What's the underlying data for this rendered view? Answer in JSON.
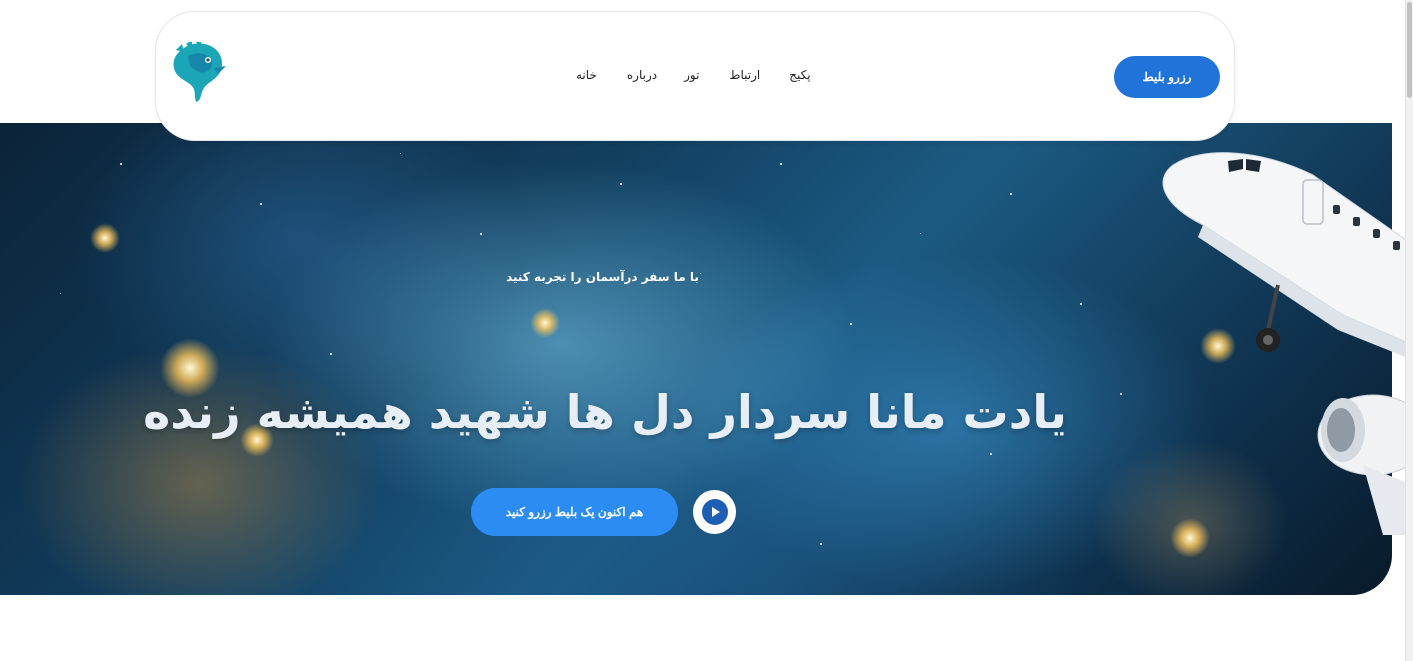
{
  "navbar": {
    "logo_name": "seahorse-logo",
    "links": [
      {
        "label": "خانه"
      },
      {
        "label": "درباره"
      },
      {
        "label": "تور"
      },
      {
        "label": "ارتباط"
      },
      {
        "label": "پکیج"
      }
    ],
    "book_button": "رزرو بلیط"
  },
  "hero": {
    "tagline": "با ما سفر درآسمان را تجربه کنید",
    "title": "یادت مانا سردار دل ها شهید همیشه زنده",
    "cta_button": "هم اکنون یک بلیط رزرو کنید",
    "play_icon": "play-icon"
  },
  "colors": {
    "primary_button": "#1f73d9",
    "cta_button": "#2b8cf4",
    "logo_teal": "#1aa6b7"
  }
}
